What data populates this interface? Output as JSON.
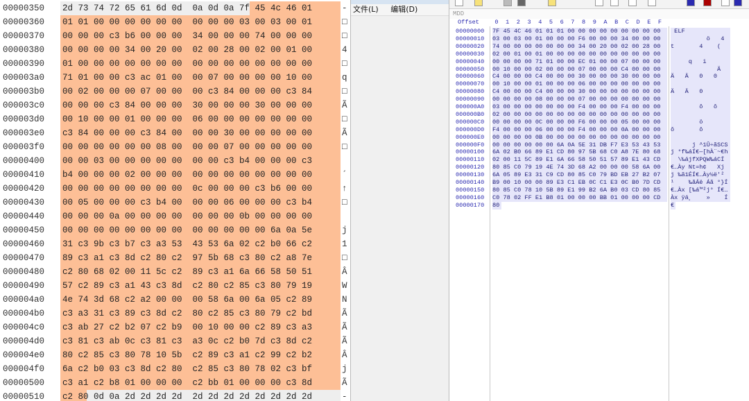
{
  "left_pane": {
    "rows": [
      {
        "addr": "00000350",
        "hex": "2d 73 74 72 65 61 6d 0d  0a 0d 0a 7f 45 4c 46 01",
        "ascii": "-"
      },
      {
        "addr": "00000360",
        "hex": "01 01 00 00 00 00 00 00  00 00 00 03 00 03 00 01",
        "ascii": "□"
      },
      {
        "addr": "00000370",
        "hex": "00 00 00 c3 b6 00 00 00  34 00 00 00 74 00 00 00",
        "ascii": "□"
      },
      {
        "addr": "00000380",
        "hex": "00 00 00 00 34 00 20 00  02 00 28 00 02 00 01 00",
        "ascii": "4"
      },
      {
        "addr": "00000390",
        "hex": "01 00 00 00 00 00 00 00  00 00 00 00 00 00 00 00",
        "ascii": "□"
      },
      {
        "addr": "000003a0",
        "hex": "71 01 00 00 c3 ac 01 00  00 07 00 00 00 00 10 00",
        "ascii": "q"
      },
      {
        "addr": "000003b0",
        "hex": "00 02 00 00 00 07 00 00  00 c3 84 00 00 00 c3 84",
        "ascii": "□"
      },
      {
        "addr": "000003c0",
        "hex": "00 00 00 c3 84 00 00 00  30 00 00 00 30 00 00 00",
        "ascii": "Ã"
      },
      {
        "addr": "000003d0",
        "hex": "00 10 00 00 01 00 00 00  06 00 00 00 00 00 00 00",
        "ascii": "□"
      },
      {
        "addr": "000003e0",
        "hex": "c3 84 00 00 00 c3 84 00  00 00 30 00 00 00 00 00",
        "ascii": "Ã"
      },
      {
        "addr": "000003f0",
        "hex": "00 00 00 00 00 00 08 00  00 00 07 00 00 00 00 00",
        "ascii": "□"
      },
      {
        "addr": "00000400",
        "hex": "00 00 03 00 00 00 00 00  00 00 c3 b4 00 00 00 c3",
        "ascii": ""
      },
      {
        "addr": "00000410",
        "hex": "b4 00 00 00 02 00 00 00  00 00 00 00 00 00 00 00",
        "ascii": "´"
      },
      {
        "addr": "00000420",
        "hex": "00 00 00 00 00 00 00 00  0c 00 00 00 c3 b6 00 00",
        "ascii": "↑"
      },
      {
        "addr": "00000430",
        "hex": "00 05 00 00 00 c3 b4 00  00 00 06 00 00 00 c3 b4",
        "ascii": "□"
      },
      {
        "addr": "00000440",
        "hex": "00 00 00 0a 00 00 00 00  00 00 00 0b 00 00 00 00",
        "ascii": ""
      },
      {
        "addr": "00000450",
        "hex": "00 00 00 00 00 00 00 00  00 00 00 00 00 6a 0a 5e",
        "ascii": "j"
      },
      {
        "addr": "00000460",
        "hex": "31 c3 9b c3 b7 c3 a3 53  43 53 6a 02 c2 b0 66 c2",
        "ascii": "1"
      },
      {
        "addr": "00000470",
        "hex": "89 c3 a1 c3 8d c2 80 c2  97 5b 68 c3 80 c2 a8 7e",
        "ascii": "□"
      },
      {
        "addr": "00000480",
        "hex": "c2 80 68 02 00 11 5c c2  89 c3 a1 6a 66 58 50 51",
        "ascii": "Â"
      },
      {
        "addr": "00000490",
        "hex": "57 c2 89 c3 a1 43 c3 8d  c2 80 c2 85 c3 80 79 19",
        "ascii": "W"
      },
      {
        "addr": "000004a0",
        "hex": "4e 74 3d 68 c2 a2 00 00  00 58 6a 00 6a 05 c2 89",
        "ascii": "N"
      },
      {
        "addr": "000004b0",
        "hex": "c3 a3 31 c3 89 c3 8d c2  80 c2 85 c3 80 79 c2 bd",
        "ascii": "Ã"
      },
      {
        "addr": "000004c0",
        "hex": "c3 ab 27 c2 b2 07 c2 b9  00 10 00 00 c2 89 c3 a3",
        "ascii": "Ã"
      },
      {
        "addr": "000004d0",
        "hex": "c3 81 c3 ab 0c c3 81 c3  a3 0c c2 b0 7d c3 8d c2",
        "ascii": "Ã"
      },
      {
        "addr": "000004e0",
        "hex": "80 c2 85 c3 80 78 10 5b  c2 89 c3 a1 c2 99 c2 b2",
        "ascii": "Â"
      },
      {
        "addr": "000004f0",
        "hex": "6a c2 b0 03 c3 8d c2 80  c2 85 c3 80 78 02 c3 bf",
        "ascii": "j"
      },
      {
        "addr": "00000500",
        "hex": "c3 a1 c2 b8 01 00 00 00  c2 bb 01 00 00 00 c3 8d",
        "ascii": "Ã"
      },
      {
        "addr": "00000510",
        "hex": "c2 80 0d 0a 2d 2d 2d 2d  2d 2d 2d 2d 2d 2d 2d 2d",
        "ascii": "-"
      }
    ]
  },
  "middle_window": {
    "menu_file": "文件(L)",
    "menu_edit": "编辑(D)"
  },
  "right_pane": {
    "subbar": "MDD",
    "header_offset": "Offset",
    "header_cols": [
      "0",
      "1",
      "2",
      "3",
      "4",
      "5",
      "6",
      "7",
      "8",
      "9",
      "A",
      "B",
      "C",
      "D",
      "E",
      "F"
    ],
    "rows": [
      {
        "addr": "00000000",
        "hex": "7F 45 4C 46 01 01 01 00 00 00 00 00 00 00 00 00",
        "ascii": " ELF"
      },
      {
        "addr": "00000010",
        "hex": "03 00 03 00 01 00 00 00 F6 00 00 00 34 00 00 00",
        "ascii": "          ö   4"
      },
      {
        "addr": "00000020",
        "hex": "74 00 00 00 00 00 00 00 34 00 20 00 02 00 28 00",
        "ascii": "t       4    ("
      },
      {
        "addr": "00000030",
        "hex": "02 00 01 00 01 00 00 00 00 00 00 00 00 00 00 00",
        "ascii": ""
      },
      {
        "addr": "00000040",
        "hex": "00 00 00 00 71 01 00 00 EC 01 00 00 07 00 00 00",
        "ascii": "     q   i"
      },
      {
        "addr": "00000050",
        "hex": "00 10 00 00 02 00 00 00 07 00 00 00 C4 00 00 00",
        "ascii": "             Ä"
      },
      {
        "addr": "00000060",
        "hex": "C4 00 00 00 C4 00 00 00 30 00 00 00 30 00 00 00",
        "ascii": "Ä   Ä   0   0"
      },
      {
        "addr": "00000070",
        "hex": "00 10 00 00 01 00 00 00 06 00 00 00 00 00 00 00",
        "ascii": ""
      },
      {
        "addr": "00000080",
        "hex": "C4 00 00 00 C4 00 00 00 30 00 00 00 00 00 00 00",
        "ascii": "Ä   Ä   0"
      },
      {
        "addr": "00000090",
        "hex": "00 00 00 00 08 00 00 00 07 00 00 00 00 00 00 00",
        "ascii": ""
      },
      {
        "addr": "000000A0",
        "hex": "03 00 00 00 00 00 00 00 F4 00 00 00 F4 00 00 00",
        "ascii": "        ô   ô"
      },
      {
        "addr": "000000B0",
        "hex": "02 00 00 00 00 00 00 00 00 00 00 00 00 00 00 00",
        "ascii": ""
      },
      {
        "addr": "000000C0",
        "hex": "00 00 00 00 0C 00 00 00 F6 00 00 00 05 00 00 00",
        "ascii": "        ö"
      },
      {
        "addr": "000000D0",
        "hex": "F4 00 00 00 06 00 00 00 F4 00 00 00 0A 00 00 00",
        "ascii": "ô       ô"
      },
      {
        "addr": "000000E0",
        "hex": "00 00 00 00 0B 00 00 00 00 00 00 00 00 00 00 00",
        "ascii": ""
      },
      {
        "addr": "000000F0",
        "hex": "00 00 00 00 00 00 6A 0A 5E 31 DB F7 E3 53 43 53",
        "ascii": "      j ^1Û÷ãSCS"
      },
      {
        "addr": "00000100",
        "hex": "6A 02 B0 66 89 E1 CD 80 97 5B 68 C0 A8 7E 80 68",
        "ascii": "j °f‰áÍ€—[hÀ¨~€h"
      },
      {
        "addr": "00000110",
        "hex": "02 00 11 5C 89 E1 6A 66 58 50 51 57 89 E1 43 CD",
        "ascii": "  \\‰ájfXPQW‰áCÍ"
      },
      {
        "addr": "00000120",
        "hex": "80 85 C0 79 19 4E 74 3D 68 A2 00 00 00 58 6A 00",
        "ascii": "€…Ày Nt=h¢   Xj"
      },
      {
        "addr": "00000130",
        "hex": "6A 05 89 E3 31 C9 CD 80 85 C0 79 BD EB 27 B2 07",
        "ascii": "j ‰ã1ÉÍ€…Ày½ë'²"
      },
      {
        "addr": "00000140",
        "hex": "B9 00 10 00 00 89 E3 C1 EB 0C C1 E3 0C B0 7D CD",
        "ascii": "¹    ‰ãÁë Áã °}Í"
      },
      {
        "addr": "00000150",
        "hex": "80 85 C0 78 10 5B 89 E1 99 B2 6A B0 03 CD 80 85",
        "ascii": "€…Àx [‰á™²j° Í€…"
      },
      {
        "addr": "00000160",
        "hex": "C0 78 02 FF E1 B8 01 00 00 00 BB 01 00 00 00 CD",
        "ascii": "Àx ÿá¸    »    Í"
      },
      {
        "addr": "00000170",
        "hex": "80",
        "ascii": "€"
      }
    ]
  }
}
